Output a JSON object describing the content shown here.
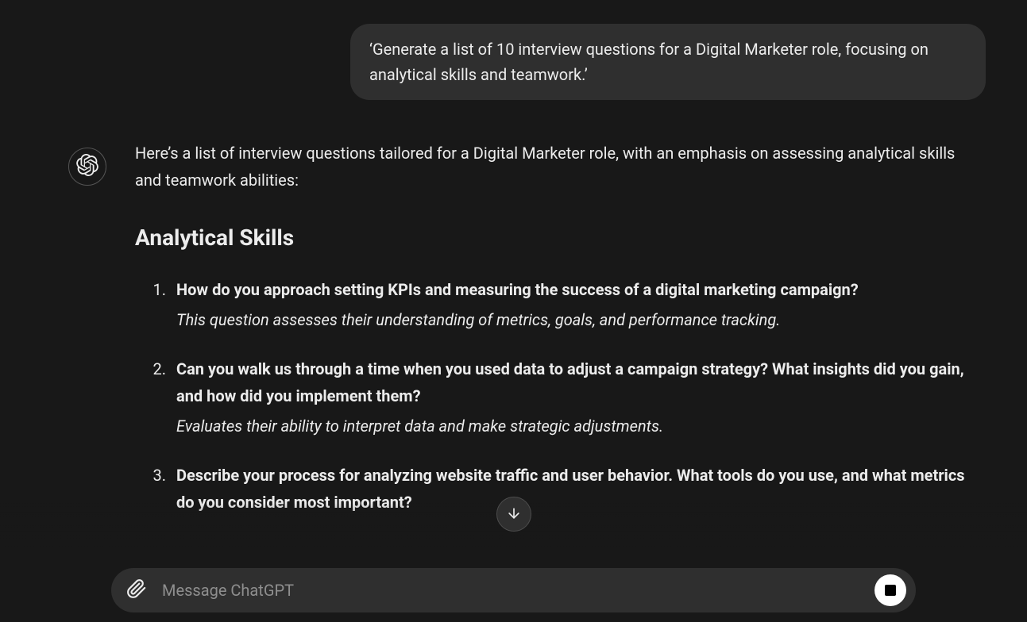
{
  "user_message": "‘Generate a list of 10 interview questions for a Digital Marketer role, focusing on analytical skills and teamwork.’",
  "assistant": {
    "intro": "Here’s a list of interview questions tailored for a Digital Marketer role, with an emphasis on assessing analytical skills and teamwork abilities:",
    "section_title": "Analytical Skills",
    "questions": [
      {
        "q": "How do you approach setting KPIs and measuring the success of a digital marketing campaign?",
        "explain": "This question assesses their understanding of metrics, goals, and performance tracking."
      },
      {
        "q": "Can you walk us through a time when you used data to adjust a campaign strategy? What insights did you gain, and how did you implement them?",
        "explain": "Evaluates their ability to interpret data and make strategic adjustments."
      },
      {
        "q": "Describe your process for analyzing website traffic and user behavior. What tools do you use, and what metrics do you consider most important?",
        "explain": ""
      }
    ]
  },
  "input": {
    "placeholder": "Message ChatGPT"
  }
}
